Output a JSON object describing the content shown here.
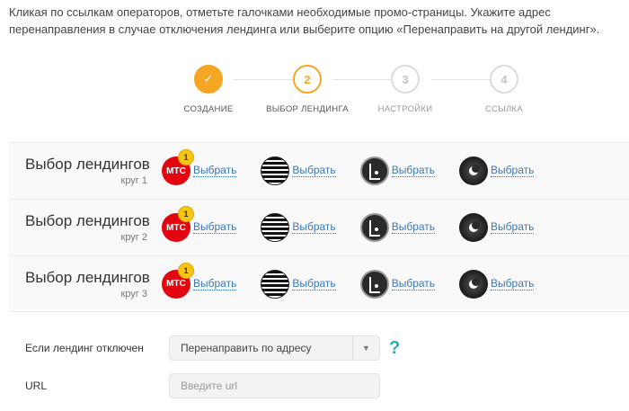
{
  "intro_text": "Кликая по ссылкам операторов, отметьте галочками необходимые промо-страницы. Укажите адрес перенаправления в случае отключения лендинга или выберите опцию «Перенаправить на другой лендинг».",
  "stepper": {
    "steps": [
      {
        "label": "СОЗДАНИЕ",
        "number": "",
        "state": "done"
      },
      {
        "label": "ВЫБОР ЛЕНДИНГА",
        "number": "2",
        "state": "active"
      },
      {
        "label": "НАСТРОЙКИ",
        "number": "3",
        "state": "todo"
      },
      {
        "label": "ССЫЛКА",
        "number": "4",
        "state": "todo"
      }
    ],
    "check_glyph": "✓"
  },
  "rounds": [
    {
      "title": "Выбор лендингов",
      "subtitle": "круг 1"
    },
    {
      "title": "Выбор лендингов",
      "subtitle": "круг 2"
    },
    {
      "title": "Выбор лендингов",
      "subtitle": "круг 3"
    }
  ],
  "operators": [
    {
      "icon": "mts-logo-icon",
      "logo_text": "МТС",
      "badge": "1",
      "link": "Выбрать"
    },
    {
      "icon": "striped-logo-icon",
      "link": "Выбрать"
    },
    {
      "icon": "tele2-logo-icon",
      "link": "Выбрать"
    },
    {
      "icon": "beeline-logo-icon",
      "link": "Выбрать"
    }
  ],
  "form": {
    "disabled_label": "Если лендинг отключен",
    "disabled_select_value": "Перенаправить по адресу",
    "help_glyph": "?",
    "url_label": "URL",
    "url_placeholder": "Введите url"
  },
  "colors": {
    "accent": "#f5a623",
    "link": "#3a78b7",
    "help": "#2aa9b8",
    "mts_red": "#e30611"
  }
}
